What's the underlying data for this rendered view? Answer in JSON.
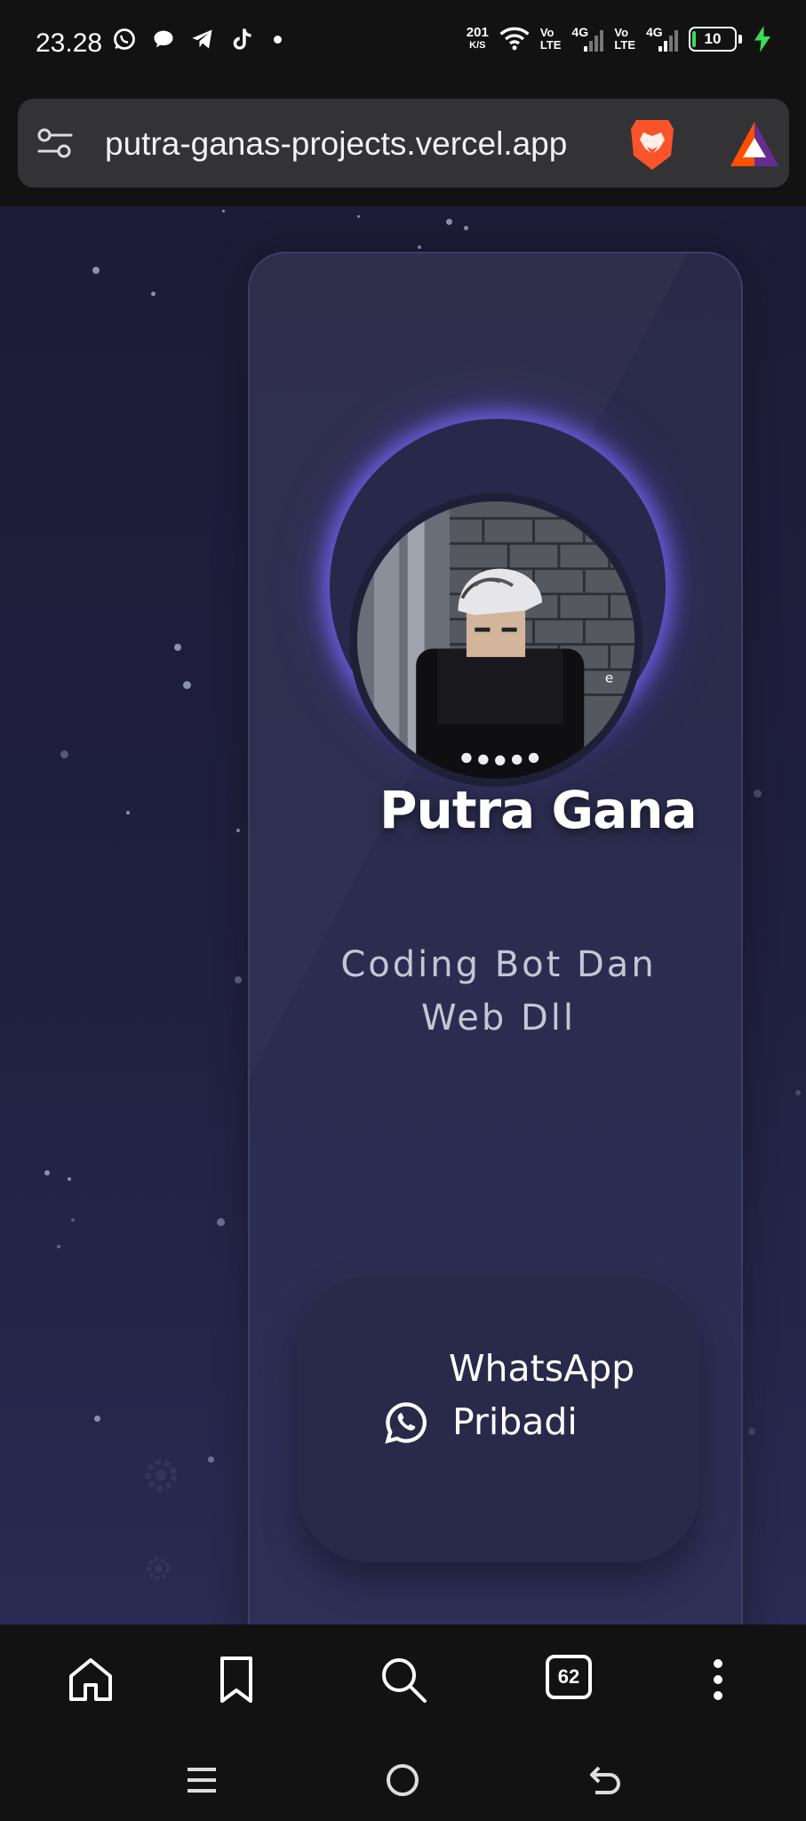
{
  "status_bar": {
    "time": "23.28",
    "left_icons": [
      "whatsapp-icon",
      "chat-bubble-icon",
      "telegram-icon",
      "tiktok-icon",
      "notification-dot-icon"
    ],
    "net_speed": "201",
    "net_speed_unit": "K/S",
    "sim1_label_top": "Vo",
    "sim1_label_bottom": "LTE",
    "sim1_network": "4G",
    "sim2_label_top": "Vo",
    "sim2_label_bottom": "LTE",
    "sim2_network": "4G",
    "battery_level": "10",
    "battery_charging": true,
    "battery_fill_color": "#3ddc5a"
  },
  "url_bar": {
    "url": "putra-ganas-projects.vercel.app",
    "left_icon": "site-settings-icon",
    "brave_icon": "brave-lion-icon",
    "rewards_icon": "brave-rewards-icon"
  },
  "profile": {
    "name": "Putra Gana",
    "tagline_line1": "Coding Bot Dan",
    "tagline_line2": "Web Dll",
    "glow_color": "#7a68ff",
    "whatsapp_line1": "WhatsApp",
    "whatsapp_line2": "Pribadi",
    "whatsapp_icon": "whatsapp-icon"
  },
  "browser_toolbar": {
    "items": [
      "home-icon",
      "bookmark-icon",
      "search-icon",
      "tabs-icon",
      "more-icon"
    ],
    "tab_count": "62"
  },
  "nav_bar": {
    "items": [
      "recents-icon",
      "home-circle-icon",
      "back-icon"
    ]
  },
  "colors": {
    "page_bg": "#1f1f3e",
    "card_bg": "#2b2b4d",
    "system_bg": "#121212"
  }
}
